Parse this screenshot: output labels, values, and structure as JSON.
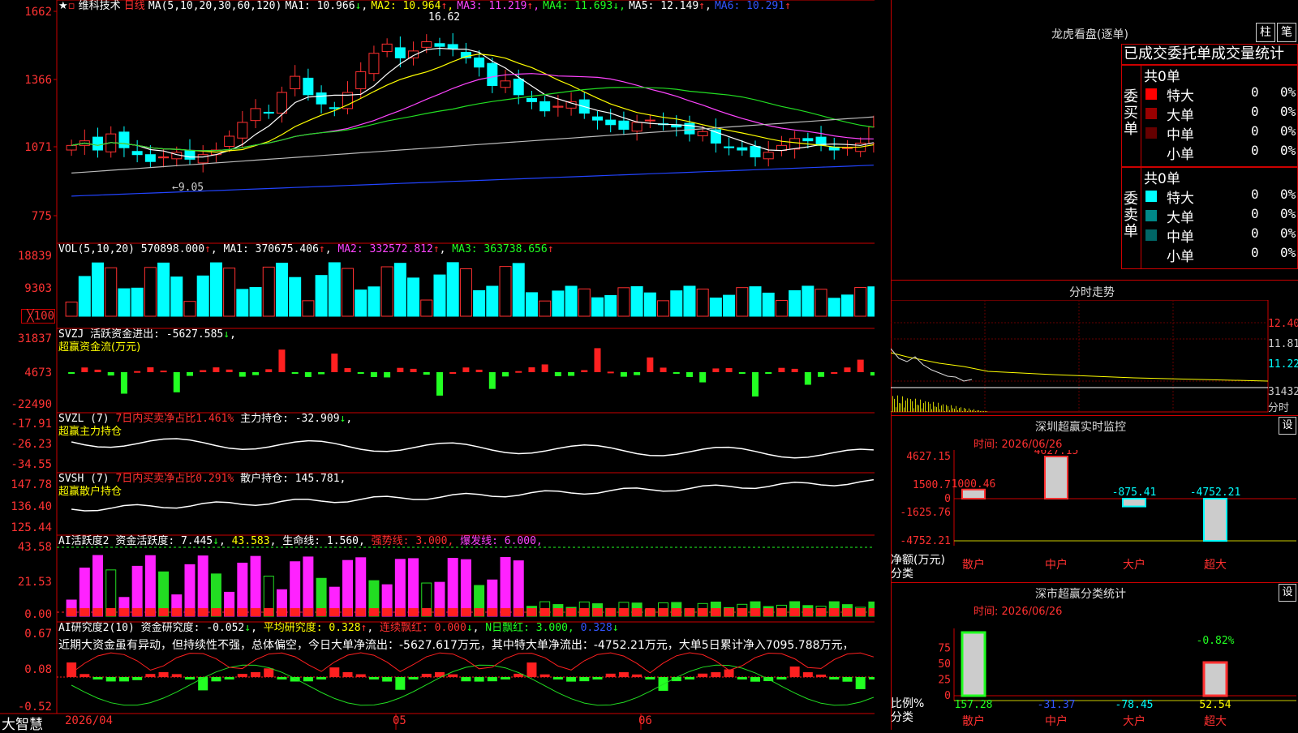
{
  "stock": {
    "name": "维科技术",
    "period": "日线",
    "ma_label": "MA(5,10,20,30,60,120)",
    "ma": [
      {
        "k": "MA1:",
        "v": "10.966"
      },
      {
        "k": "MA2:",
        "v": "10.964"
      },
      {
        "k": "MA3:",
        "v": "11.219"
      },
      {
        "k": "MA4:",
        "v": "11.693"
      },
      {
        "k": "MA5:",
        "v": "12.149"
      },
      {
        "k": "MA6:",
        "v": "10.291"
      }
    ],
    "arrows": [
      "↓",
      "↑",
      "↑",
      "↓",
      "↑",
      "↑"
    ],
    "high_label": "16.62",
    "low_label": "←9.05",
    "price_ticks": [
      "1662",
      "1366",
      "1071",
      "775"
    ]
  },
  "vol": {
    "label": "VOL(5,10,20)",
    "value": "570898.000",
    "ma1": "MA1: 370675.406",
    "ma2": "MA2: 332572.812",
    "ma3": "MA3: 363738.656",
    "ticks": [
      "18839",
      "9303",
      "╳100"
    ]
  },
  "svzj": {
    "label": "SVZJ",
    "name": "活跃资金进出:",
    "value": "-5627.585",
    "sub": "超赢资金流(万元)",
    "ticks": [
      "31837",
      "4673",
      "-22490"
    ]
  },
  "svzl": {
    "label": "SVZL (7)",
    "ratio": "7日内买卖净占比1.461%",
    "name": "主力持仓:",
    "value": "-32.909",
    "sub": "超赢主力持仓",
    "ticks": [
      "-17.91",
      "-26.23",
      "-34.55"
    ]
  },
  "svsh": {
    "label": "SVSH (7)",
    "ratio": "7日内买卖净占比0.291%",
    "name": "散户持仓:",
    "value": "145.781",
    "sub": "超赢散户持仓",
    "ticks": [
      "147.78",
      "136.40",
      "125.44"
    ]
  },
  "ai1": {
    "label": "AI活跃度2",
    "name": "资金活跃度:",
    "value": "7.445",
    "v2": "43.583",
    "life": "生命线: 1.560,",
    "strong": "强势线: 3.000,",
    "burst": "爆发线: 6.000,",
    "ticks": [
      "43.58",
      "21.53",
      "0.00"
    ]
  },
  "ai2": {
    "label": "AI研究度2(10)",
    "name": "资金研究度:",
    "value": "-0.052",
    "avg": "平均研究度: 0.328",
    "red": "连续飘红: 0.000",
    "nred": "N日飘红: 3.000,",
    "nval": "0.328",
    "ticks": [
      "0.67",
      "0.08",
      "-0.52"
    ],
    "comment": "近期大资金虽有异动，但持续性不强，总体偏空，今日大单净流出：-5627.617万元，其中特大单净流出：-4752.21万元，大单5日累计净入7095.788万元，"
  },
  "bottom": {
    "brand": "大智慧",
    "date": "2026/04",
    "m5": "05",
    "m6": "06"
  },
  "lhb": {
    "title": "龙虎看盘(逐单)",
    "btn1": "柱",
    "btn2": "笔",
    "tabs": "已成交委托单成交量统计",
    "buy": {
      "side": "委买单",
      "count": "共0单",
      "rows": [
        {
          "n": "特大",
          "v": "0",
          "p": "0%",
          "c": "#ff0000"
        },
        {
          "n": "大单",
          "v": "0",
          "p": "0%",
          "c": "#990000"
        },
        {
          "n": "中单",
          "v": "0",
          "p": "0%",
          "c": "#660000"
        },
        {
          "n": "小单",
          "v": "0",
          "p": "0%",
          "c": ""
        }
      ]
    },
    "sell": {
      "side": "委卖单",
      "count": "共0单",
      "rows": [
        {
          "n": "特大",
          "v": "0",
          "p": "0%",
          "c": "#00ffff"
        },
        {
          "n": "大单",
          "v": "0",
          "p": "0%",
          "c": "#008888"
        },
        {
          "n": "中单",
          "v": "0",
          "p": "0%",
          "c": "#006666"
        },
        {
          "n": "小单",
          "v": "0",
          "p": "0%",
          "c": ""
        }
      ]
    }
  },
  "fenshi": {
    "title": "分时走势",
    "ticks": [
      "12.40",
      "11.81",
      "11.22",
      "31432",
      "分时"
    ]
  },
  "szmon": {
    "title": "深圳超赢实时监控",
    "btn": "设",
    "time": "时间: 2026/06/26",
    "ticks": [
      "4627.15",
      "1500.7",
      "0",
      "-1625.76",
      "-4752.21"
    ],
    "ylab": "净额(万元)",
    "xlab": "分类",
    "cats": [
      "散户",
      "中户",
      "大户",
      "超大"
    ],
    "vals": [
      "1000.46",
      "4627.15",
      "-875.41",
      "-4752.21"
    ]
  },
  "szcls": {
    "title": "深市超赢分类统计",
    "btn": "设",
    "time": "时间: 2026/06/26",
    "ticks": [
      "75",
      "50",
      "25",
      "0"
    ],
    "ylab": "比例%",
    "xlab": "分类",
    "cats": [
      "散户",
      "中户",
      "大户",
      "超大"
    ],
    "vals": [
      "157.28",
      "-31.37",
      "-78.45",
      "52.54"
    ],
    "extra": "-0.82%"
  },
  "chart_data": {
    "type": "candlestick",
    "x_range": [
      "2026/04",
      "2026/06"
    ],
    "ylim": [
      7.75,
      16.62
    ],
    "high": 16.62,
    "low": 9.05,
    "closes": [
      10.8,
      11.0,
      10.6,
      11.3,
      10.7,
      10.4,
      10.1,
      10.3,
      10.5,
      10.2,
      10.4,
      10.6,
      11.2,
      11.8,
      12.4,
      12.2,
      13.1,
      13.8,
      13.0,
      12.6,
      12.4,
      13.1,
      14.0,
      14.8,
      15.2,
      14.6,
      14.9,
      15.3,
      15.1,
      15.0,
      14.6,
      14.2,
      13.4,
      13.6,
      13.0,
      12.7,
      12.3,
      12.5,
      12.7,
      12.2,
      11.9,
      11.7,
      11.5,
      11.8,
      11.9,
      11.7,
      11.6,
      11.3,
      11.4,
      10.9,
      10.7,
      10.6,
      10.3,
      10.5,
      10.8,
      11.1,
      11.0,
      10.8,
      10.6,
      10.7,
      10.9,
      11.6
    ]
  }
}
